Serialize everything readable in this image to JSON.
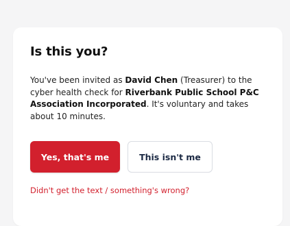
{
  "card": {
    "title": "Is this you?",
    "invite": {
      "part1": "You've been invited as ",
      "name": "David Chen",
      "part2": " (Treasurer) to the cyber health check for ",
      "organisation": "Riverbank Public School P&C Association Incorporated",
      "part3": ". It's voluntary and takes about 10 minutes."
    },
    "confirm_button": "Yes, that's me",
    "deny_button": "This isn't me",
    "help_link": "Didn't get the text / something's wrong?"
  },
  "colors": {
    "page_background": "#f5f5f6",
    "card_background": "#ffffff",
    "primary": "#d2202d",
    "secondary_text": "#1c2a44",
    "secondary_border": "#d9dce2"
  }
}
